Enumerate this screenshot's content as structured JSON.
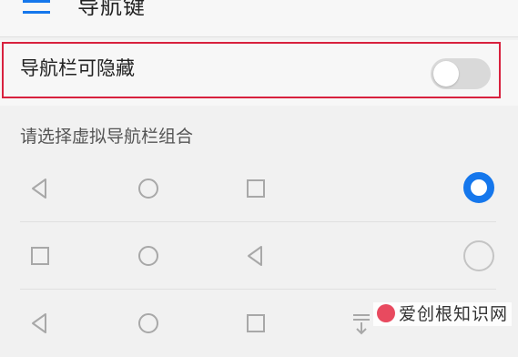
{
  "header": {
    "title": "导航键",
    "menu_icon": "menu-icon"
  },
  "toggle": {
    "label": "导航栏可隐藏",
    "enabled": false
  },
  "section": {
    "label": "请选择虚拟导航栏组合"
  },
  "combos": [
    {
      "keys": [
        "back",
        "home",
        "recent"
      ],
      "selected": true
    },
    {
      "keys": [
        "recent",
        "home",
        "back"
      ],
      "selected": false
    },
    {
      "keys": [
        "back",
        "home",
        "recent",
        "notification"
      ],
      "selected": false
    }
  ],
  "watermark": {
    "text": "爱创根知识网"
  },
  "colors": {
    "accent": "#1577ec",
    "highlight_border": "#d8213e",
    "icon_gray": "#a8a8a8",
    "background": "#f1f1f1"
  }
}
